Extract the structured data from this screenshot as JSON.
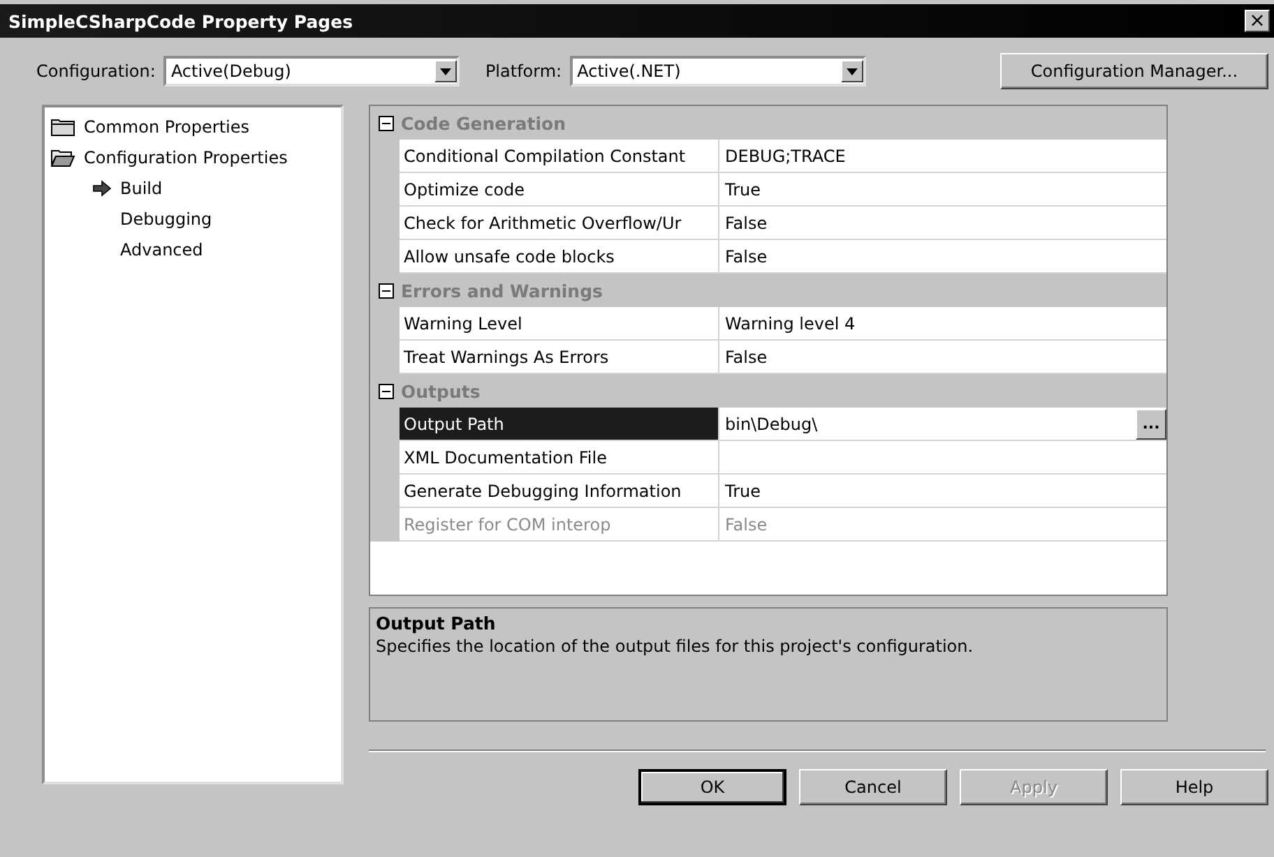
{
  "window": {
    "title": "SimpleCSharpCode Property Pages",
    "close": "×"
  },
  "toolbar": {
    "configuration": {
      "label": "Configuration:",
      "value": "Active(Debug)"
    },
    "platform": {
      "label": "Platform:",
      "value": "Active(.NET)"
    },
    "manager_button": "Configuration Manager..."
  },
  "tree": [
    {
      "label": "Common Properties",
      "expanded": false,
      "selected": false
    },
    {
      "label": "Configuration Properties",
      "expanded": true,
      "selected": false,
      "children": [
        {
          "label": "Build",
          "selected": true
        },
        {
          "label": "Debugging",
          "selected": false
        },
        {
          "label": "Advanced",
          "selected": false
        }
      ]
    }
  ],
  "grid": [
    {
      "category": "Code Generation",
      "expanded": true,
      "properties": [
        {
          "name": "Conditional Compilation Constant",
          "value": "DEBUG;TRACE",
          "selected": false,
          "disabled": false
        },
        {
          "name": "Optimize code",
          "value": "True",
          "selected": false,
          "disabled": false
        },
        {
          "name": "Check for Arithmetic Overflow/Ur",
          "value": "False",
          "selected": false,
          "disabled": false
        },
        {
          "name": "Allow unsafe code blocks",
          "value": "False",
          "selected": false,
          "disabled": false
        }
      ]
    },
    {
      "category": "Errors and Warnings",
      "expanded": true,
      "properties": [
        {
          "name": "Warning Level",
          "value": "Warning level 4",
          "selected": false,
          "disabled": false
        },
        {
          "name": "Treat Warnings As Errors",
          "value": "False",
          "selected": false,
          "disabled": false
        }
      ]
    },
    {
      "category": "Outputs",
      "expanded": true,
      "properties": [
        {
          "name": "Output Path",
          "value": "bin\\Debug\\",
          "selected": true,
          "disabled": false,
          "browse": "..."
        },
        {
          "name": "XML Documentation File",
          "selected": false,
          "disabled": false
        },
        {
          "name": "Generate Debugging Information",
          "value": "True",
          "selected": false,
          "disabled": false
        },
        {
          "name": "Register for COM interop",
          "value": "False",
          "selected": false,
          "disabled": true
        }
      ]
    }
  ],
  "description": {
    "title": "Output Path",
    "text": "Specifies the location of the output files for this project's configuration."
  },
  "buttons": [
    {
      "label": "OK",
      "default": true,
      "disabled": false
    },
    {
      "label": "Cancel",
      "default": false,
      "disabled": false
    },
    {
      "label": "Apply",
      "default": false,
      "disabled": true
    },
    {
      "label": "Help",
      "default": false,
      "disabled": false
    }
  ]
}
